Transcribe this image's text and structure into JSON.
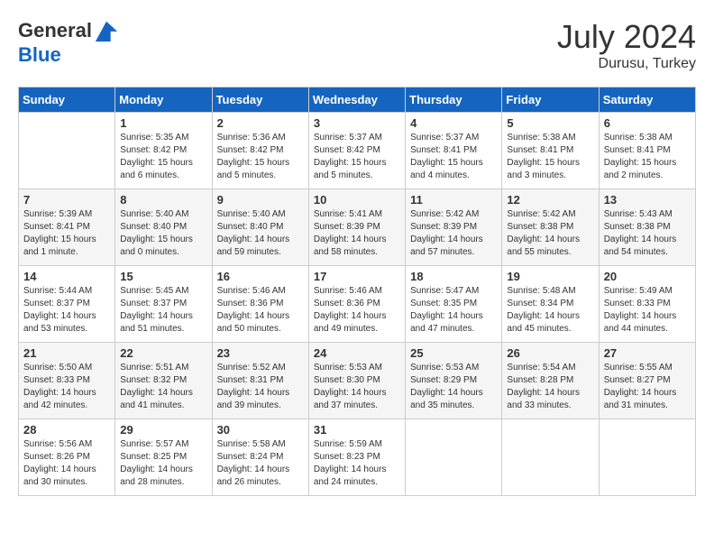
{
  "header": {
    "logo_general": "General",
    "logo_blue": "Blue",
    "month_year": "July 2024",
    "location": "Durusu, Turkey"
  },
  "days_of_week": [
    "Sunday",
    "Monday",
    "Tuesday",
    "Wednesday",
    "Thursday",
    "Friday",
    "Saturday"
  ],
  "weeks": [
    [
      {
        "day": "",
        "sunrise": "",
        "sunset": "",
        "daylight": ""
      },
      {
        "day": "1",
        "sunrise": "Sunrise: 5:35 AM",
        "sunset": "Sunset: 8:42 PM",
        "daylight": "Daylight: 15 hours and 6 minutes."
      },
      {
        "day": "2",
        "sunrise": "Sunrise: 5:36 AM",
        "sunset": "Sunset: 8:42 PM",
        "daylight": "Daylight: 15 hours and 5 minutes."
      },
      {
        "day": "3",
        "sunrise": "Sunrise: 5:37 AM",
        "sunset": "Sunset: 8:42 PM",
        "daylight": "Daylight: 15 hours and 5 minutes."
      },
      {
        "day": "4",
        "sunrise": "Sunrise: 5:37 AM",
        "sunset": "Sunset: 8:41 PM",
        "daylight": "Daylight: 15 hours and 4 minutes."
      },
      {
        "day": "5",
        "sunrise": "Sunrise: 5:38 AM",
        "sunset": "Sunset: 8:41 PM",
        "daylight": "Daylight: 15 hours and 3 minutes."
      },
      {
        "day": "6",
        "sunrise": "Sunrise: 5:38 AM",
        "sunset": "Sunset: 8:41 PM",
        "daylight": "Daylight: 15 hours and 2 minutes."
      }
    ],
    [
      {
        "day": "7",
        "sunrise": "Sunrise: 5:39 AM",
        "sunset": "Sunset: 8:41 PM",
        "daylight": "Daylight: 15 hours and 1 minute."
      },
      {
        "day": "8",
        "sunrise": "Sunrise: 5:40 AM",
        "sunset": "Sunset: 8:40 PM",
        "daylight": "Daylight: 15 hours and 0 minutes."
      },
      {
        "day": "9",
        "sunrise": "Sunrise: 5:40 AM",
        "sunset": "Sunset: 8:40 PM",
        "daylight": "Daylight: 14 hours and 59 minutes."
      },
      {
        "day": "10",
        "sunrise": "Sunrise: 5:41 AM",
        "sunset": "Sunset: 8:39 PM",
        "daylight": "Daylight: 14 hours and 58 minutes."
      },
      {
        "day": "11",
        "sunrise": "Sunrise: 5:42 AM",
        "sunset": "Sunset: 8:39 PM",
        "daylight": "Daylight: 14 hours and 57 minutes."
      },
      {
        "day": "12",
        "sunrise": "Sunrise: 5:42 AM",
        "sunset": "Sunset: 8:38 PM",
        "daylight": "Daylight: 14 hours and 55 minutes."
      },
      {
        "day": "13",
        "sunrise": "Sunrise: 5:43 AM",
        "sunset": "Sunset: 8:38 PM",
        "daylight": "Daylight: 14 hours and 54 minutes."
      }
    ],
    [
      {
        "day": "14",
        "sunrise": "Sunrise: 5:44 AM",
        "sunset": "Sunset: 8:37 PM",
        "daylight": "Daylight: 14 hours and 53 minutes."
      },
      {
        "day": "15",
        "sunrise": "Sunrise: 5:45 AM",
        "sunset": "Sunset: 8:37 PM",
        "daylight": "Daylight: 14 hours and 51 minutes."
      },
      {
        "day": "16",
        "sunrise": "Sunrise: 5:46 AM",
        "sunset": "Sunset: 8:36 PM",
        "daylight": "Daylight: 14 hours and 50 minutes."
      },
      {
        "day": "17",
        "sunrise": "Sunrise: 5:46 AM",
        "sunset": "Sunset: 8:36 PM",
        "daylight": "Daylight: 14 hours and 49 minutes."
      },
      {
        "day": "18",
        "sunrise": "Sunrise: 5:47 AM",
        "sunset": "Sunset: 8:35 PM",
        "daylight": "Daylight: 14 hours and 47 minutes."
      },
      {
        "day": "19",
        "sunrise": "Sunrise: 5:48 AM",
        "sunset": "Sunset: 8:34 PM",
        "daylight": "Daylight: 14 hours and 45 minutes."
      },
      {
        "day": "20",
        "sunrise": "Sunrise: 5:49 AM",
        "sunset": "Sunset: 8:33 PM",
        "daylight": "Daylight: 14 hours and 44 minutes."
      }
    ],
    [
      {
        "day": "21",
        "sunrise": "Sunrise: 5:50 AM",
        "sunset": "Sunset: 8:33 PM",
        "daylight": "Daylight: 14 hours and 42 minutes."
      },
      {
        "day": "22",
        "sunrise": "Sunrise: 5:51 AM",
        "sunset": "Sunset: 8:32 PM",
        "daylight": "Daylight: 14 hours and 41 minutes."
      },
      {
        "day": "23",
        "sunrise": "Sunrise: 5:52 AM",
        "sunset": "Sunset: 8:31 PM",
        "daylight": "Daylight: 14 hours and 39 minutes."
      },
      {
        "day": "24",
        "sunrise": "Sunrise: 5:53 AM",
        "sunset": "Sunset: 8:30 PM",
        "daylight": "Daylight: 14 hours and 37 minutes."
      },
      {
        "day": "25",
        "sunrise": "Sunrise: 5:53 AM",
        "sunset": "Sunset: 8:29 PM",
        "daylight": "Daylight: 14 hours and 35 minutes."
      },
      {
        "day": "26",
        "sunrise": "Sunrise: 5:54 AM",
        "sunset": "Sunset: 8:28 PM",
        "daylight": "Daylight: 14 hours and 33 minutes."
      },
      {
        "day": "27",
        "sunrise": "Sunrise: 5:55 AM",
        "sunset": "Sunset: 8:27 PM",
        "daylight": "Daylight: 14 hours and 31 minutes."
      }
    ],
    [
      {
        "day": "28",
        "sunrise": "Sunrise: 5:56 AM",
        "sunset": "Sunset: 8:26 PM",
        "daylight": "Daylight: 14 hours and 30 minutes."
      },
      {
        "day": "29",
        "sunrise": "Sunrise: 5:57 AM",
        "sunset": "Sunset: 8:25 PM",
        "daylight": "Daylight: 14 hours and 28 minutes."
      },
      {
        "day": "30",
        "sunrise": "Sunrise: 5:58 AM",
        "sunset": "Sunset: 8:24 PM",
        "daylight": "Daylight: 14 hours and 26 minutes."
      },
      {
        "day": "31",
        "sunrise": "Sunrise: 5:59 AM",
        "sunset": "Sunset: 8:23 PM",
        "daylight": "Daylight: 14 hours and 24 minutes."
      },
      {
        "day": "",
        "sunrise": "",
        "sunset": "",
        "daylight": ""
      },
      {
        "day": "",
        "sunrise": "",
        "sunset": "",
        "daylight": ""
      },
      {
        "day": "",
        "sunrise": "",
        "sunset": "",
        "daylight": ""
      }
    ]
  ]
}
